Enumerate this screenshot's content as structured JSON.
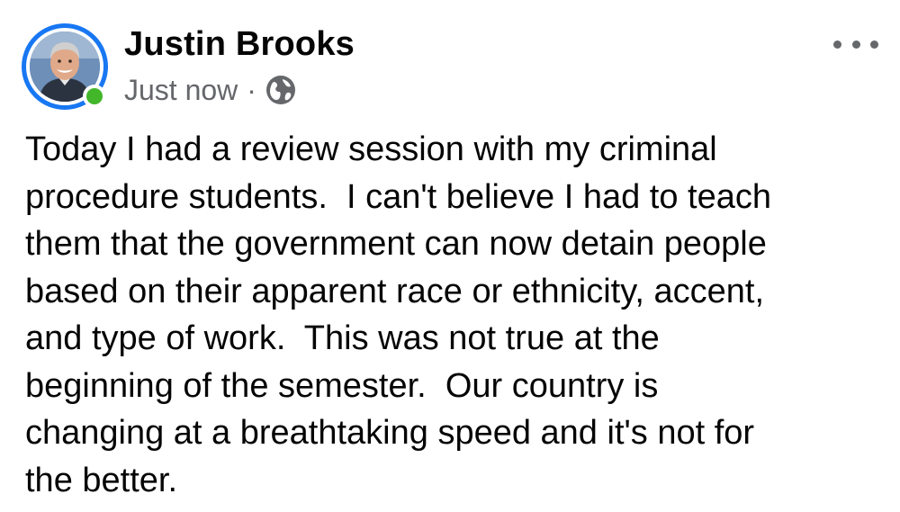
{
  "post": {
    "author": "Justin Brooks",
    "timestamp": "Just now",
    "separator": "·",
    "privacy_icon": "globe-icon",
    "more_icon": "more-horizontal-icon",
    "body_lines": [
      "Today I had a review session with my criminal",
      "procedure students.  I can't believe I had to teach",
      "them that the government can now detain people",
      "based on their apparent race or ethnicity, accent,",
      "and type of work.  This was not true at the",
      "beginning of the semester.  Our country is",
      "changing at a breathtaking speed and it's not for",
      "the better."
    ]
  },
  "colors": {
    "ring": "#1877f2",
    "online": "#42b72a",
    "secondary_text": "#65676b",
    "primary_text": "#050505"
  }
}
